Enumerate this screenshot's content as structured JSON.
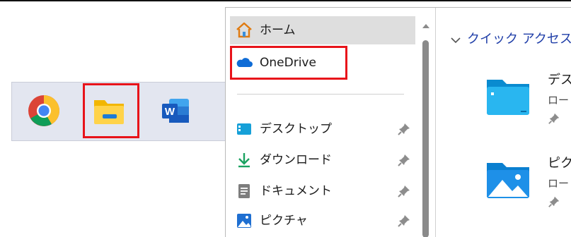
{
  "taskbar": {
    "apps": [
      {
        "name": "Google Chrome",
        "icon": "chrome-icon"
      },
      {
        "name": "File Explorer",
        "icon": "file-explorer-icon",
        "highlighted": true
      },
      {
        "name": "Microsoft Word",
        "icon": "word-icon",
        "glyph": "W"
      }
    ]
  },
  "explorer": {
    "nav": {
      "home": {
        "label": "ホーム",
        "icon": "home-icon",
        "selected": true
      },
      "onedrive": {
        "label": "OneDrive",
        "icon": "onedrive-cloud-icon",
        "highlighted": true
      },
      "pinned": [
        {
          "label": "デスクトップ",
          "icon": "desktop-folder-icon",
          "pinned": true
        },
        {
          "label": "ダウンロード",
          "icon": "download-arrow-icon",
          "pinned": true
        },
        {
          "label": "ドキュメント",
          "icon": "document-icon",
          "pinned": true
        },
        {
          "label": "ピクチャ",
          "icon": "pictures-icon",
          "pinned": true
        }
      ]
    },
    "content": {
      "section_title": "クイック アクセス",
      "items": [
        {
          "name": "デス",
          "location": "ロー",
          "icon": "desktop-folder-icon"
        },
        {
          "name": "ピク",
          "location": "ロー",
          "icon": "pictures-folder-icon"
        }
      ]
    }
  },
  "colors": {
    "highlight_box": "#e8131a",
    "selected_bg": "#dedede",
    "link_blue": "#1f3ea8",
    "taskbar_bg": "#e3e6f0"
  }
}
